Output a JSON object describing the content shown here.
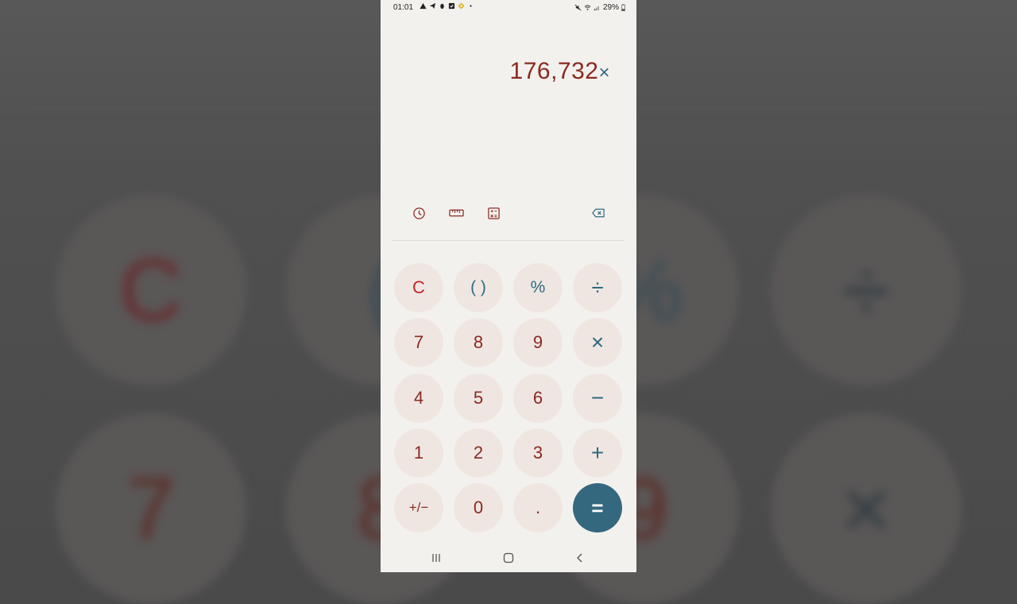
{
  "background": {
    "blurred_keys": [
      "C",
      "(",
      "%",
      "÷",
      "7",
      "8",
      "9",
      "×"
    ]
  },
  "status_bar": {
    "time": "01:01",
    "battery": "29%"
  },
  "display": {
    "expression": "176,732",
    "operator": "×"
  },
  "toolbar": {
    "history_icon": "clock-icon",
    "converter_icon": "ruler-icon",
    "scientific_icon": "calculator-icon",
    "backspace_icon": "backspace-icon"
  },
  "keypad": {
    "row1": [
      "C",
      "( )",
      "%",
      "÷"
    ],
    "row2": [
      "7",
      "8",
      "9",
      "×"
    ],
    "row3": [
      "4",
      "5",
      "6",
      "−"
    ],
    "row4": [
      "1",
      "2",
      "3",
      "+"
    ],
    "row5": [
      "+/−",
      "0",
      ".",
      "="
    ]
  },
  "colors": {
    "digit": "#8a2a20",
    "operator": "#2f6b80",
    "clear": "#c0282c",
    "equals_bg": "#34687f",
    "key_bg": "#efe6e2",
    "screen_bg": "#f3f1ee"
  }
}
